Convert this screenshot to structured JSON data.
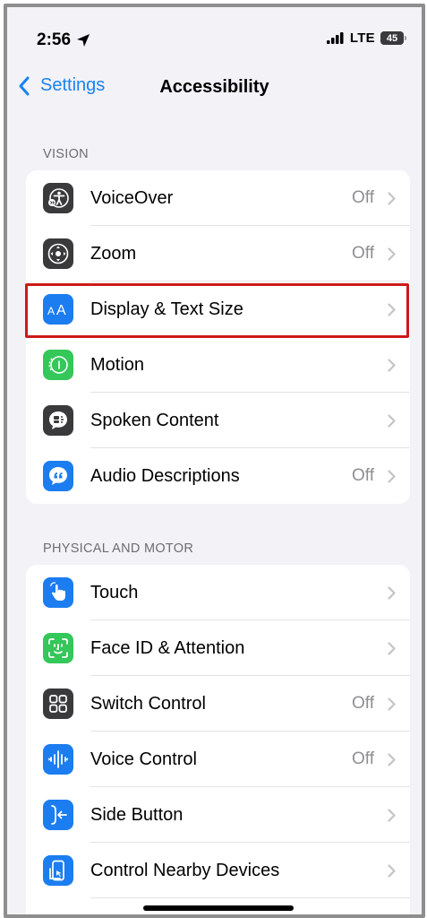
{
  "status_bar": {
    "time": "2:56",
    "network": "LTE",
    "battery": "45"
  },
  "nav": {
    "back_label": "Settings",
    "title": "Accessibility"
  },
  "sections": [
    {
      "header": "VISION",
      "rows": [
        {
          "label": "VoiceOver",
          "value": "Off",
          "icon": "voiceover-icon",
          "color": "#3a3a3c"
        },
        {
          "label": "Zoom",
          "value": "Off",
          "icon": "zoom-icon",
          "color": "#3a3a3c"
        },
        {
          "label": "Display & Text Size",
          "value": "",
          "icon": "text-size-icon",
          "color": "#1c7df0"
        },
        {
          "label": "Motion",
          "value": "",
          "icon": "motion-icon",
          "color": "#34c759"
        },
        {
          "label": "Spoken Content",
          "value": "",
          "icon": "spoken-content-icon",
          "color": "#3a3a3c"
        },
        {
          "label": "Audio Descriptions",
          "value": "Off",
          "icon": "audio-descriptions-icon",
          "color": "#1c7df0"
        }
      ]
    },
    {
      "header": "PHYSICAL AND MOTOR",
      "rows": [
        {
          "label": "Touch",
          "value": "",
          "icon": "touch-icon",
          "color": "#1c7df0"
        },
        {
          "label": "Face ID & Attention",
          "value": "",
          "icon": "face-id-icon",
          "color": "#34c759"
        },
        {
          "label": "Switch Control",
          "value": "Off",
          "icon": "switch-control-icon",
          "color": "#3a3a3c"
        },
        {
          "label": "Voice Control",
          "value": "Off",
          "icon": "voice-control-icon",
          "color": "#1c7df0"
        },
        {
          "label": "Side Button",
          "value": "",
          "icon": "side-button-icon",
          "color": "#1c7df0"
        },
        {
          "label": "Control Nearby Devices",
          "value": "",
          "icon": "nearby-devices-icon",
          "color": "#1c7df0"
        }
      ]
    }
  ],
  "highlighted_row": "Display & Text Size",
  "highlight_color": "#cc1a1a"
}
